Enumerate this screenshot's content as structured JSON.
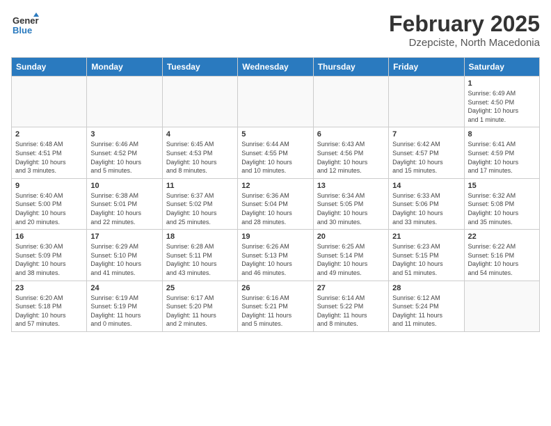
{
  "header": {
    "logo_general": "General",
    "logo_blue": "Blue",
    "month": "February 2025",
    "location": "Dzepciste, North Macedonia"
  },
  "weekdays": [
    "Sunday",
    "Monday",
    "Tuesday",
    "Wednesday",
    "Thursday",
    "Friday",
    "Saturday"
  ],
  "weeks": [
    [
      {
        "day": "",
        "info": ""
      },
      {
        "day": "",
        "info": ""
      },
      {
        "day": "",
        "info": ""
      },
      {
        "day": "",
        "info": ""
      },
      {
        "day": "",
        "info": ""
      },
      {
        "day": "",
        "info": ""
      },
      {
        "day": "1",
        "info": "Sunrise: 6:49 AM\nSunset: 4:50 PM\nDaylight: 10 hours\nand 1 minute."
      }
    ],
    [
      {
        "day": "2",
        "info": "Sunrise: 6:48 AM\nSunset: 4:51 PM\nDaylight: 10 hours\nand 3 minutes."
      },
      {
        "day": "3",
        "info": "Sunrise: 6:46 AM\nSunset: 4:52 PM\nDaylight: 10 hours\nand 5 minutes."
      },
      {
        "day": "4",
        "info": "Sunrise: 6:45 AM\nSunset: 4:53 PM\nDaylight: 10 hours\nand 8 minutes."
      },
      {
        "day": "5",
        "info": "Sunrise: 6:44 AM\nSunset: 4:55 PM\nDaylight: 10 hours\nand 10 minutes."
      },
      {
        "day": "6",
        "info": "Sunrise: 6:43 AM\nSunset: 4:56 PM\nDaylight: 10 hours\nand 12 minutes."
      },
      {
        "day": "7",
        "info": "Sunrise: 6:42 AM\nSunset: 4:57 PM\nDaylight: 10 hours\nand 15 minutes."
      },
      {
        "day": "8",
        "info": "Sunrise: 6:41 AM\nSunset: 4:59 PM\nDaylight: 10 hours\nand 17 minutes."
      }
    ],
    [
      {
        "day": "9",
        "info": "Sunrise: 6:40 AM\nSunset: 5:00 PM\nDaylight: 10 hours\nand 20 minutes."
      },
      {
        "day": "10",
        "info": "Sunrise: 6:38 AM\nSunset: 5:01 PM\nDaylight: 10 hours\nand 22 minutes."
      },
      {
        "day": "11",
        "info": "Sunrise: 6:37 AM\nSunset: 5:02 PM\nDaylight: 10 hours\nand 25 minutes."
      },
      {
        "day": "12",
        "info": "Sunrise: 6:36 AM\nSunset: 5:04 PM\nDaylight: 10 hours\nand 28 minutes."
      },
      {
        "day": "13",
        "info": "Sunrise: 6:34 AM\nSunset: 5:05 PM\nDaylight: 10 hours\nand 30 minutes."
      },
      {
        "day": "14",
        "info": "Sunrise: 6:33 AM\nSunset: 5:06 PM\nDaylight: 10 hours\nand 33 minutes."
      },
      {
        "day": "15",
        "info": "Sunrise: 6:32 AM\nSunset: 5:08 PM\nDaylight: 10 hours\nand 35 minutes."
      }
    ],
    [
      {
        "day": "16",
        "info": "Sunrise: 6:30 AM\nSunset: 5:09 PM\nDaylight: 10 hours\nand 38 minutes."
      },
      {
        "day": "17",
        "info": "Sunrise: 6:29 AM\nSunset: 5:10 PM\nDaylight: 10 hours\nand 41 minutes."
      },
      {
        "day": "18",
        "info": "Sunrise: 6:28 AM\nSunset: 5:11 PM\nDaylight: 10 hours\nand 43 minutes."
      },
      {
        "day": "19",
        "info": "Sunrise: 6:26 AM\nSunset: 5:13 PM\nDaylight: 10 hours\nand 46 minutes."
      },
      {
        "day": "20",
        "info": "Sunrise: 6:25 AM\nSunset: 5:14 PM\nDaylight: 10 hours\nand 49 minutes."
      },
      {
        "day": "21",
        "info": "Sunrise: 6:23 AM\nSunset: 5:15 PM\nDaylight: 10 hours\nand 51 minutes."
      },
      {
        "day": "22",
        "info": "Sunrise: 6:22 AM\nSunset: 5:16 PM\nDaylight: 10 hours\nand 54 minutes."
      }
    ],
    [
      {
        "day": "23",
        "info": "Sunrise: 6:20 AM\nSunset: 5:18 PM\nDaylight: 10 hours\nand 57 minutes."
      },
      {
        "day": "24",
        "info": "Sunrise: 6:19 AM\nSunset: 5:19 PM\nDaylight: 11 hours\nand 0 minutes."
      },
      {
        "day": "25",
        "info": "Sunrise: 6:17 AM\nSunset: 5:20 PM\nDaylight: 11 hours\nand 2 minutes."
      },
      {
        "day": "26",
        "info": "Sunrise: 6:16 AM\nSunset: 5:21 PM\nDaylight: 11 hours\nand 5 minutes."
      },
      {
        "day": "27",
        "info": "Sunrise: 6:14 AM\nSunset: 5:22 PM\nDaylight: 11 hours\nand 8 minutes."
      },
      {
        "day": "28",
        "info": "Sunrise: 6:12 AM\nSunset: 5:24 PM\nDaylight: 11 hours\nand 11 minutes."
      },
      {
        "day": "",
        "info": ""
      }
    ]
  ]
}
